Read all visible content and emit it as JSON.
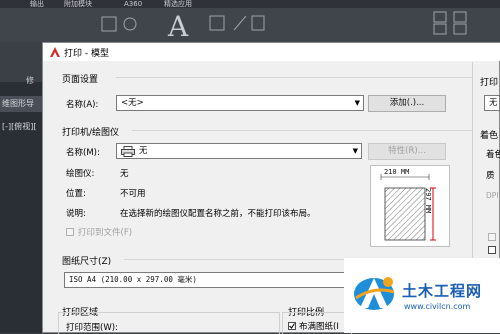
{
  "ribbon": {
    "tabs": [
      "输出",
      "附加模块",
      "A360",
      "精选应用"
    ],
    "letter": "A",
    "panel_label": "修"
  },
  "workspace": {
    "tab_label": "维图形导",
    "viewport_label": "[-][俯视][",
    "left_char": "修"
  },
  "dialog": {
    "title": "打印 - 模型",
    "page_setup": {
      "section": "页面设置",
      "name_label": "名称(A):",
      "name_value": "<无>",
      "add_button": "添加(.)..."
    },
    "printer": {
      "section": "打印机/绘图仪",
      "name_label": "名称(M):",
      "name_value": "无",
      "properties_button": "特性(R)...",
      "plotter_label": "绘图仪:",
      "plotter_value": "无",
      "location_label": "位置:",
      "location_value": "不可用",
      "description_label": "说明:",
      "description_value": "在选择新的绘图仪配置名称之前，不能打印该布局。",
      "print_to_file_label": "打印到文件(F)"
    },
    "preview": {
      "width_label": "210 MM",
      "height_label": "297 MM"
    },
    "paper_size": {
      "section": "图纸尺寸(Z)",
      "value": "ISO A4 (210.00 x 297.00 毫米)"
    },
    "plot_area": {
      "section": "打印区域",
      "range_label": "打印范围(W):"
    },
    "plot_scale": {
      "section": "打印比例",
      "fit_label": "布满图纸(I"
    },
    "right_panel": {
      "section1": "打印",
      "combo_value": "无",
      "section2": "着色",
      "label_a": "着色",
      "label_b": "质",
      "label_c": "DPI"
    }
  },
  "watermark": {
    "text": "土木工程网",
    "url": "www.civilcn.com"
  }
}
